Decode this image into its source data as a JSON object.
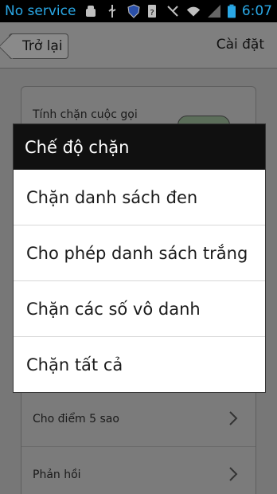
{
  "status_bar": {
    "carrier": "No service",
    "time": "6:07",
    "left_icons": [
      "android-debug-icon",
      "usb-icon",
      "shield-icon"
    ],
    "right_icons": [
      "sim-alert-icon",
      "no-signal-icon",
      "wifi-icon",
      "signal-icon",
      "battery-icon"
    ]
  },
  "app_bar": {
    "back_label": "Trở lại",
    "title": "Cài đặt"
  },
  "background": {
    "rows": [
      {
        "label": "Tính chặn cuộc gọi"
      },
      {
        "label": "Cho điểm 5 sao"
      },
      {
        "label": "Phản hồi"
      }
    ]
  },
  "dialog": {
    "title": "Chế độ chặn",
    "options": [
      {
        "label": "Chặn danh sách đen"
      },
      {
        "label": "Cho phép danh sách trắng"
      },
      {
        "label": "Chặn các số vô danh"
      },
      {
        "label": "Chặn tất cả"
      }
    ]
  },
  "colors": {
    "status_accent": "#2aa8e6",
    "dialog_header": "#101010",
    "dim_background": "#777777"
  }
}
